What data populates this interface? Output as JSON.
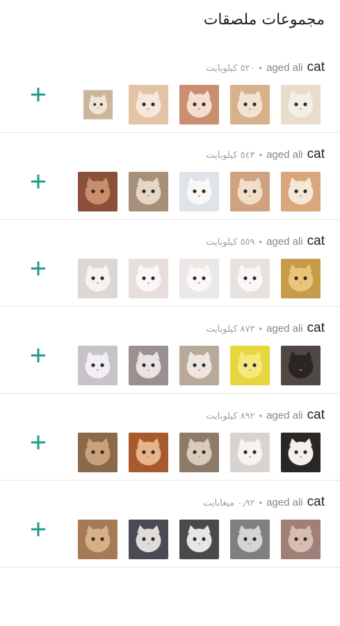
{
  "header": {
    "title": "مجموعات ملصقات"
  },
  "colors": {
    "accent": "#1f9b87",
    "divider": "#e4e4e4",
    "muted": "#9aa0a6"
  },
  "packs": [
    {
      "name": "cat",
      "author": "aged ali",
      "size": "٥٢٠ كيلوبايت",
      "stickers": [
        {
          "icon": "cat-sticker-icon",
          "bg": "#e9dccb",
          "fg": "#f4efe6"
        },
        {
          "icon": "cat-sticker-icon",
          "bg": "#d7b18b",
          "fg": "#f1e3d0"
        },
        {
          "icon": "cat-sticker-icon",
          "bg": "#c98f6f",
          "fg": "#f3ded0"
        },
        {
          "icon": "cat-sticker-icon",
          "bg": "#e2c3a4",
          "fg": "#f5e7da"
        },
        {
          "icon": "cat-sticker-icon",
          "bg": "#cbb59b",
          "fg": "#efe4d7"
        }
      ]
    },
    {
      "name": "cat",
      "author": "aged ali",
      "size": "٥٤٣ كيلوبايت",
      "stickers": [
        {
          "icon": "cat-sticker-icon",
          "bg": "#d8a77c",
          "fg": "#f6e8d6"
        },
        {
          "icon": "cat-sticker-icon",
          "bg": "#cfa381",
          "fg": "#f2dec8"
        },
        {
          "icon": "cat-sticker-icon",
          "bg": "#dfe3ea",
          "fg": "#f8f8f8"
        },
        {
          "icon": "cat-sticker-icon",
          "bg": "#a7907a",
          "fg": "#e6d6c5"
        },
        {
          "icon": "cat-sticker-icon",
          "bg": "#8c4f3a",
          "fg": "#c98e6b"
        }
      ]
    },
    {
      "name": "cat",
      "author": "aged ali",
      "size": "٥٥٩ كيلوبايت",
      "stickers": [
        {
          "icon": "cat-sticker-icon",
          "bg": "#c69b4a",
          "fg": "#e9c47a"
        },
        {
          "icon": "cat-sticker-icon",
          "bg": "#e7e2de",
          "fg": "#faf8f6"
        },
        {
          "icon": "cat-sticker-icon",
          "bg": "#ece8e6",
          "fg": "#fbf9f8"
        },
        {
          "icon": "cat-sticker-icon",
          "bg": "#e8dfdc",
          "fg": "#fbf7f6"
        },
        {
          "icon": "cat-sticker-icon",
          "bg": "#ddd7d3",
          "fg": "#f7f3f1"
        }
      ]
    },
    {
      "name": "cat",
      "author": "aged ali",
      "size": "٨٧٣ كيلوبايت",
      "stickers": [
        {
          "icon": "cat-sticker-icon",
          "bg": "#4f4845",
          "fg": "#2a2523"
        },
        {
          "icon": "cat-sticker-icon",
          "bg": "#e6d640",
          "fg": "#f4e97a"
        },
        {
          "icon": "cat-sticker-icon",
          "bg": "#b8a99b",
          "fg": "#efe7df"
        },
        {
          "icon": "cat-sticker-icon",
          "bg": "#9b8f90",
          "fg": "#e9e3e3"
        },
        {
          "icon": "cat-sticker-icon",
          "bg": "#c7c3c9",
          "fg": "#f2eff3"
        }
      ]
    },
    {
      "name": "cat",
      "author": "aged ali",
      "size": "٨٩٢ كيلوبايت",
      "stickers": [
        {
          "icon": "cat-sticker-icon",
          "bg": "#2a2624",
          "fg": "#f2f0ee"
        },
        {
          "icon": "cat-sticker-icon",
          "bg": "#d9d3cf",
          "fg": "#f6f3f1"
        },
        {
          "icon": "cat-sticker-icon",
          "bg": "#8c7b68",
          "fg": "#d9cbbb"
        },
        {
          "icon": "cat-sticker-icon",
          "bg": "#a65a2e",
          "fg": "#e8b48a"
        },
        {
          "icon": "cat-sticker-icon",
          "bg": "#8b6a4c",
          "fg": "#c9a27c"
        }
      ]
    },
    {
      "name": "cat",
      "author": "aged ali",
      "size": "٠٫٩٢ ميغابايت",
      "stickers": [
        {
          "icon": "cat-sticker-icon",
          "bg": "#a07f78",
          "fg": "#d8bcb2"
        },
        {
          "icon": "cat-sticker-icon",
          "bg": "#7f7f7f",
          "fg": "#d4d4d4"
        },
        {
          "icon": "cat-sticker-icon",
          "bg": "#4a4a4a",
          "fg": "#e6e6e6"
        },
        {
          "icon": "cat-sticker-icon",
          "bg": "#4b4a52",
          "fg": "#e0dcda"
        },
        {
          "icon": "cat-sticker-icon",
          "bg": "#a57a55",
          "fg": "#d7b08a"
        }
      ]
    }
  ]
}
